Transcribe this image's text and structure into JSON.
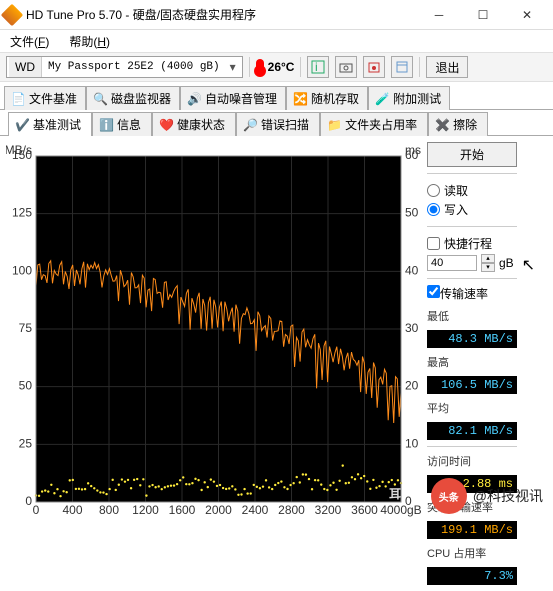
{
  "window": {
    "title": "HD Tune Pro 5.70 - 硬盘/固态硬盘实用程序"
  },
  "menu": {
    "file": "文件(",
    "file_u": "F",
    "file_end": ")",
    "help": "帮助(",
    "help_u": "H",
    "help_end": ")"
  },
  "toolbar": {
    "drive_prefix": "WD",
    "drive": "My Passport 25E2 (4000 gB)",
    "temp": "26°C",
    "exit": "退出"
  },
  "tabs": {
    "row1": [
      "文件基准",
      "磁盘监视器",
      "自动噪音管理",
      "随机存取",
      "附加测试"
    ],
    "row2": [
      "基准测试",
      "信息",
      "健康状态",
      "错误扫描",
      "文件夹占用率",
      "擦除"
    ],
    "active1": -1,
    "active2": 0
  },
  "side": {
    "start": "开始",
    "read": "读取",
    "write": "写入",
    "mode": "write",
    "short": "快捷行程",
    "short_on": false,
    "short_val": "40",
    "short_unit": "gB",
    "xfer": "传输速率",
    "xfer_on": true,
    "min_l": "最低",
    "min_v": "48.3 MB/s",
    "max_l": "最高",
    "max_v": "106.5 MB/s",
    "avg_l": "平均",
    "avg_v": "82.1 MB/s",
    "acc_l": "访问时间",
    "acc_v": "2.88 ms",
    "burst_l": "突发传输速率",
    "burst_v": "199.1 MB/s",
    "cpu_l": "CPU 占用率",
    "cpu_v": "7.3%"
  },
  "axes": {
    "y_unit_left": "MB/s",
    "y_unit_right": "ms",
    "y_left": [
      "150",
      "125",
      "100",
      "75",
      "50",
      "25",
      "0"
    ],
    "y_right": [
      "60",
      "50",
      "40",
      "30",
      "20",
      "10",
      "0"
    ],
    "x": [
      "0",
      "400",
      "800",
      "1200",
      "1600",
      "2000",
      "2400",
      "2800",
      "3200",
      "3600",
      "4000gB"
    ]
  },
  "chart_data": {
    "type": "line",
    "title": "",
    "xlabel": "",
    "ylabel_left": "MB/s",
    "ylabel_right": "ms",
    "xlim": [
      0,
      4000
    ],
    "ylim_left": [
      0,
      150
    ],
    "ylim_right": [
      0,
      60
    ],
    "series": [
      {
        "name": "transfer_rate_MBps",
        "axis": "left",
        "x": [
          0,
          200,
          400,
          600,
          800,
          1000,
          1200,
          1400,
          1600,
          1800,
          2000,
          2200,
          2400,
          2600,
          2800,
          3000,
          3200,
          3400,
          3600,
          3800,
          4000
        ],
        "values": [
          100,
          102,
          100,
          103,
          99,
          97,
          95,
          93,
          90,
          88,
          86,
          83,
          80,
          77,
          74,
          71,
          67,
          64,
          60,
          55,
          50
        ]
      },
      {
        "name": "access_time_ms",
        "axis": "right",
        "x": [
          0,
          200,
          400,
          600,
          800,
          1000,
          1200,
          1400,
          1600,
          1800,
          2000,
          2200,
          2400,
          2600,
          2800,
          3000,
          3200,
          3400,
          3600,
          3800,
          4000
        ],
        "values": [
          2,
          2,
          3,
          2,
          3,
          3,
          2,
          3,
          4,
          3,
          3,
          2,
          3,
          3,
          4,
          3,
          3,
          4,
          3,
          3,
          3
        ]
      }
    ]
  },
  "watermark": {
    "badge": "头条",
    "text": "@科技视讯"
  }
}
